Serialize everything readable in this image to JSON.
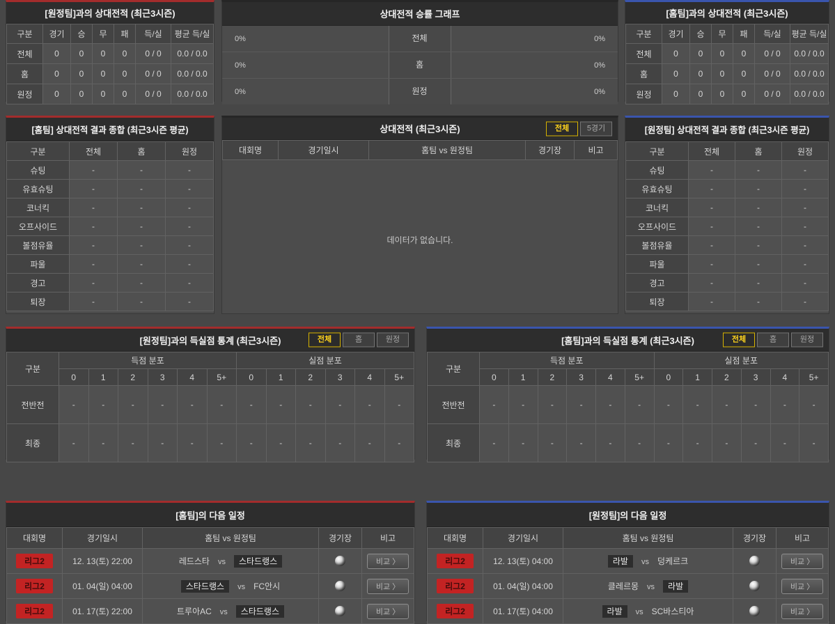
{
  "record_vs_away": {
    "title": "[원정팀]과의 상대전적 (최근3시즌)",
    "columns": [
      "구분",
      "경기",
      "승",
      "무",
      "패",
      "득/실",
      "평균 득/실"
    ],
    "rows": [
      {
        "label": "전체",
        "values": [
          "0",
          "0",
          "0",
          "0",
          "0 / 0",
          "0.0 / 0.0"
        ]
      },
      {
        "label": "홈",
        "values": [
          "0",
          "0",
          "0",
          "0",
          "0 / 0",
          "0.0 / 0.0"
        ]
      },
      {
        "label": "원정",
        "values": [
          "0",
          "0",
          "0",
          "0",
          "0 / 0",
          "0.0 / 0.0"
        ]
      }
    ]
  },
  "win_rate_graph": {
    "title": "상대전적 승률 그래프",
    "rows": [
      {
        "left_pct": "0%",
        "label": "전체",
        "right_pct": "0%"
      },
      {
        "left_pct": "0%",
        "label": "홈",
        "right_pct": "0%"
      },
      {
        "left_pct": "0%",
        "label": "원정",
        "right_pct": "0%"
      }
    ]
  },
  "record_vs_home": {
    "title": "[홈팀]과의 상대전적 (최근3시즌)",
    "columns": [
      "구분",
      "경기",
      "승",
      "무",
      "패",
      "득/실",
      "평균 득/실"
    ],
    "rows": [
      {
        "label": "전체",
        "values": [
          "0",
          "0",
          "0",
          "0",
          "0 / 0",
          "0.0 / 0.0"
        ]
      },
      {
        "label": "홈",
        "values": [
          "0",
          "0",
          "0",
          "0",
          "0 / 0",
          "0.0 / 0.0"
        ]
      },
      {
        "label": "원정",
        "values": [
          "0",
          "0",
          "0",
          "0",
          "0 / 0",
          "0.0 / 0.0"
        ]
      }
    ]
  },
  "summary_home": {
    "title": "[홈팀] 상대전적 결과 종합 (최근3시즌 평균)",
    "columns": [
      "구분",
      "전체",
      "홈",
      "원정"
    ],
    "row_labels": [
      "슈팅",
      "유효슈팅",
      "코너킥",
      "오프사이드",
      "볼점유율",
      "파울",
      "경고",
      "퇴장"
    ],
    "empty_value": "-"
  },
  "h2h_matches": {
    "title": "상대전적 (최근3시즌)",
    "tabs": [
      "전체",
      "5경기"
    ],
    "active_tab": "전체",
    "columns": [
      "대회명",
      "경기일시",
      "홈팀  vs  원정팀",
      "경기장",
      "비고"
    ],
    "empty_message": "데이터가 없습니다."
  },
  "summary_away": {
    "title": "[원정팀] 상대전적 결과 종합 (최근3시즌 평균)",
    "columns": [
      "구분",
      "전체",
      "홈",
      "원정"
    ],
    "row_labels": [
      "슈팅",
      "유효슈팅",
      "코너킥",
      "오프사이드",
      "볼점유율",
      "파울",
      "경고",
      "퇴장"
    ],
    "empty_value": "-"
  },
  "goal_stats_vs_away": {
    "title": "[원정팀]과의 득실점 통계 (최근3시즌)",
    "tabs": [
      "전체",
      "홈",
      "원정"
    ],
    "active_tab": "전체",
    "corner_label": "구분",
    "groups": [
      "득점 분포",
      "실점 분포"
    ],
    "bins": [
      "0",
      "1",
      "2",
      "3",
      "4",
      "5+"
    ],
    "row_labels": [
      "전반전",
      "최종"
    ],
    "empty_value": "-"
  },
  "goal_stats_vs_home": {
    "title": "[홈팀]과의 득실점 통계 (최근3시즌)",
    "tabs": [
      "전체",
      "홈",
      "원정"
    ],
    "active_tab": "전체",
    "corner_label": "구분",
    "groups": [
      "득점 분포",
      "실점 분포"
    ],
    "bins": [
      "0",
      "1",
      "2",
      "3",
      "4",
      "5+"
    ],
    "row_labels": [
      "전반전",
      "최종"
    ],
    "empty_value": "-"
  },
  "schedule_home": {
    "title": "[홈팀]의 다음 일정",
    "columns": [
      "대회명",
      "경기일시",
      "홈팀  vs  원정팀",
      "경기장",
      "비고"
    ],
    "rows": [
      {
        "league": "리그2",
        "datetime": "12. 13(토) 22:00",
        "home": "레드스타",
        "vs": "vs",
        "away": "스타드랭스",
        "compare": "비교 〉"
      },
      {
        "league": "리그2",
        "datetime": "01. 04(일) 04:00",
        "home": "스타드랭스",
        "vs": "vs",
        "away": "FC안시",
        "compare": "비교 〉"
      },
      {
        "league": "리그2",
        "datetime": "01. 17(토) 22:00",
        "home": "트루아AC",
        "vs": "vs",
        "away": "스타드랭스",
        "compare": "비교 〉"
      }
    ]
  },
  "schedule_away": {
    "title": "[원정팀]의 다음 일정",
    "columns": [
      "대회명",
      "경기일시",
      "홈팀  vs  원정팀",
      "경기장",
      "비고"
    ],
    "rows": [
      {
        "league": "리그2",
        "datetime": "12. 13(토) 04:00",
        "home": "라발",
        "vs": "vs",
        "away": "덩케르크",
        "compare": "비교 〉"
      },
      {
        "league": "리그2",
        "datetime": "01. 04(일) 04:00",
        "home": "클레르몽",
        "vs": "vs",
        "away": "라발",
        "compare": "비교 〉"
      },
      {
        "league": "리그2",
        "datetime": "01. 17(토) 04:00",
        "home": "라발",
        "vs": "vs",
        "away": "SC바스티아",
        "compare": "비교 〉"
      }
    ]
  },
  "colors": {
    "accent_red": "#a32c2c",
    "accent_blue": "#3a55ad",
    "badge_red": "#c32323",
    "tab_active_yellow": "#ffd41c"
  }
}
